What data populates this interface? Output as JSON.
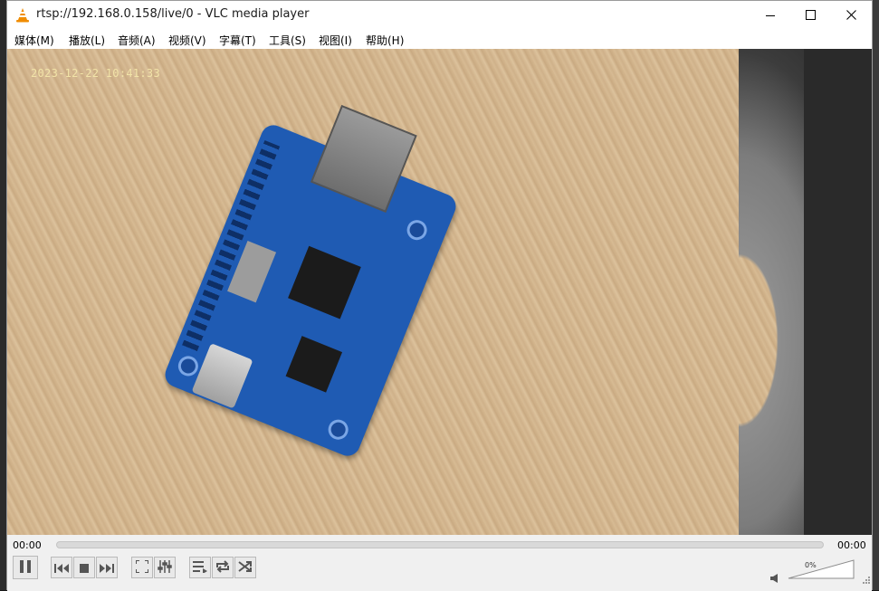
{
  "window": {
    "title": "rtsp://192.168.0.158/live/0 - VLC media player",
    "controls": [
      "minimize-icon",
      "maximize-icon",
      "close-icon"
    ]
  },
  "menu": {
    "items": [
      {
        "label": "媒体(M)"
      },
      {
        "label": "播放(L)"
      },
      {
        "label": "音频(A)"
      },
      {
        "label": "视频(V)"
      },
      {
        "label": "字幕(T)"
      },
      {
        "label": "工具(S)"
      },
      {
        "label": "视图(I)"
      },
      {
        "label": "帮助(H)"
      }
    ]
  },
  "video": {
    "timestamp": "2023-12-22   10:41:33"
  },
  "playback": {
    "elapsed": "00:00",
    "total": "00:00",
    "position": 0,
    "buttons": [
      "pause-icon",
      "previous-icon",
      "stop-icon",
      "next-icon",
      "fullscreen-icon",
      "extended-settings-icon",
      "playlist-icon",
      "loop-icon",
      "shuffle-icon"
    ]
  },
  "volume": {
    "label": "0%",
    "level": 0
  },
  "colors": {
    "titlebar": "#ffffff",
    "chrome": "#f0f0f0",
    "board": "#1f5bb3",
    "timestamp_text": "#f2e4a8"
  }
}
